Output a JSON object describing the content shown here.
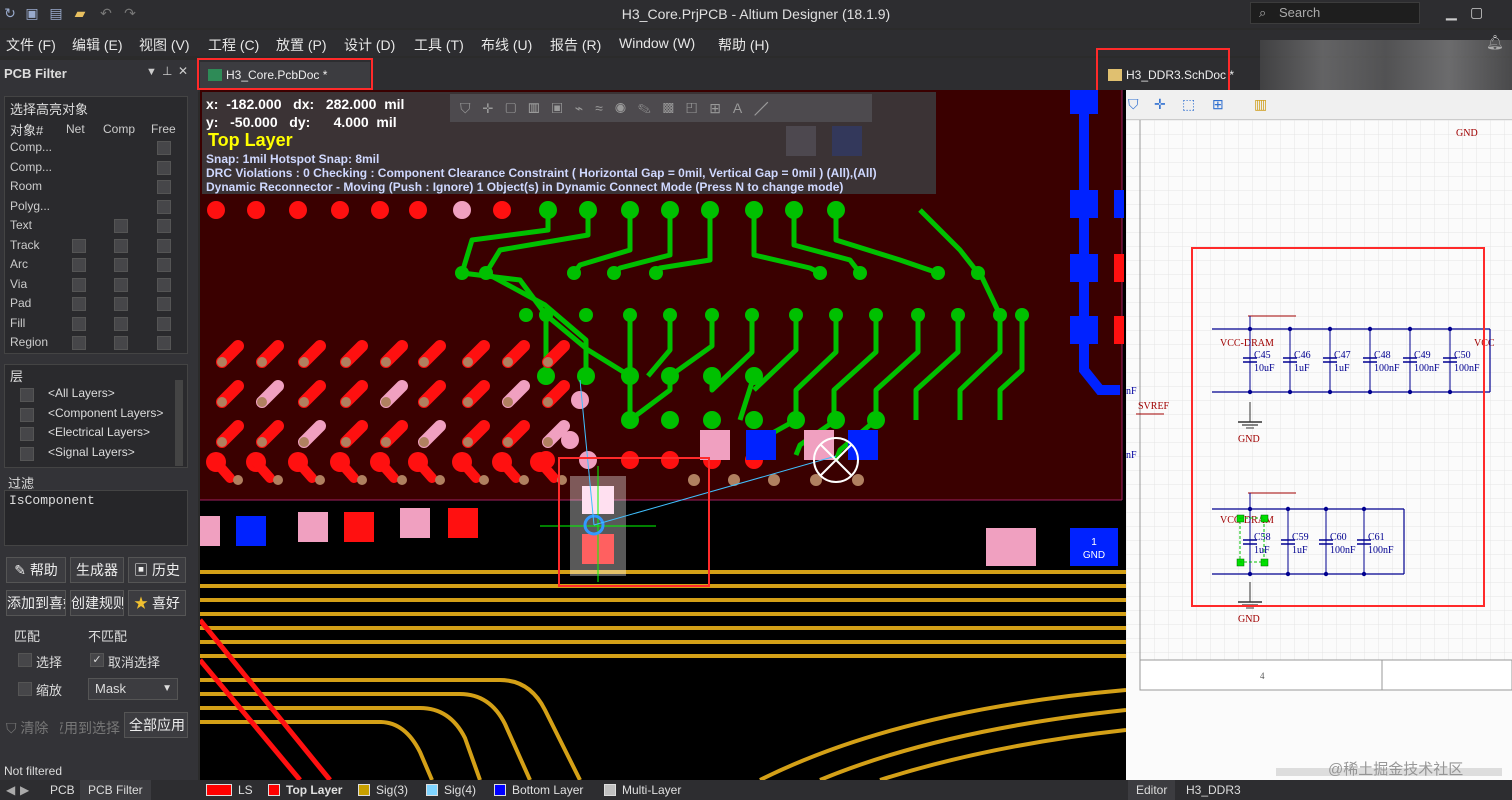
{
  "window": {
    "title": "H3_Core.PrjPCB - Altium Designer (18.1.9)",
    "search_placeholder": "Search"
  },
  "menu": [
    "文件 (F)",
    "编辑 (E)",
    "视图 (V)",
    "工程 (C)",
    "放置 (P)",
    "设计 (D)",
    "工具 (T)",
    "布线 (U)",
    "报告 (R)",
    "Window (W)",
    "帮助 (H)"
  ],
  "panel": {
    "title": "PCB Filter",
    "highlight_title": "选择高亮对象",
    "obj_headers": [
      "对象#",
      "Net",
      "Comp",
      "Free"
    ],
    "objects": [
      "Comp...",
      "Comp...",
      "Room",
      "Polyg...",
      "Text",
      "Track",
      "Arc",
      "Via",
      "Pad",
      "Fill",
      "Region"
    ],
    "layers_title": "层",
    "layers": [
      "<All Layers>",
      "<Component Layers>",
      "<Electrical Layers>",
      "<Signal Layers>"
    ],
    "filter_title": "过滤",
    "filter_text": "IsComponent",
    "buttons": {
      "help": "帮助",
      "builder": "生成器",
      "history": "历史",
      "add_to": "添加到喜好",
      "create_rule": "创建规则",
      "favorite": "喜好"
    },
    "match": "匹配",
    "nomatch": "不匹配",
    "select": "选择",
    "deselect": "取消选择",
    "zoom": "缩放",
    "mask": "Mask",
    "clear": "清除",
    "apply_to": "应用到选择",
    "apply_all": "全部应用"
  },
  "tabs": {
    "pcb": "H3_Core.PcbDoc *",
    "sch": "H3_DDR3.SchDoc *"
  },
  "hud": {
    "x_line": "x:  -182.000   dx:   282.000  mil",
    "y_line": "y:   -50.000   dy:      4.000  mil",
    "layer": "Top Layer",
    "snap": "Snap: 1mil Hotspot Snap: 8mil",
    "drc": "DRC Violations : 0 Checking : Component Clearance Constraint ( Horizontal Gap = 0mil, Vertical Gap = 0mil ) (All),(All)",
    "reconnector": "Dynamic Reconnector - Moving (Push : Ignore) 1 Object(s) in Dynamic Connect Mode (Press N to change mode)"
  },
  "pcb_labels": {
    "gnd_pad": "1",
    "gnd_net": "GND"
  },
  "schematic": {
    "gnd": "GND",
    "vcc1": "VCC-DRAM",
    "vcc2": "VCC-DRAM",
    "vcc_right": "VCC",
    "svref": "SVREF",
    "nf1": "nF",
    "nf2": "nF",
    "row1": [
      {
        "ref": "C45",
        "val": "10uF"
      },
      {
        "ref": "C46",
        "val": "1uF"
      },
      {
        "ref": "C47",
        "val": "1uF"
      },
      {
        "ref": "C48",
        "val": "100nF"
      },
      {
        "ref": "C49",
        "val": "100nF"
      },
      {
        "ref": "C50",
        "val": "100nF"
      }
    ],
    "row2": [
      {
        "ref": "C58",
        "val": "1uF"
      },
      {
        "ref": "C59",
        "val": "1uF"
      },
      {
        "ref": "C60",
        "val": "100nF"
      },
      {
        "ref": "C61",
        "val": "100nF"
      }
    ],
    "frame_num": "4"
  },
  "status": {
    "text": "Not filtered"
  },
  "bottom_tabs": [
    "PCB",
    "PCB Filter"
  ],
  "layer_tabs": [
    {
      "label": "LS",
      "color": "#ff0000"
    },
    {
      "label": "Top Layer",
      "color": "#ff0000"
    },
    {
      "label": "Sig(3)",
      "color": "#c8a000"
    },
    {
      "label": "Sig(4)",
      "color": "#7fd4ff"
    },
    {
      "label": "Bottom Layer",
      "color": "#0000ff"
    },
    {
      "label": "Multi-Layer",
      "color": "#c0c0c0"
    }
  ],
  "sch_tabs": [
    "Editor",
    "H3_DDR3"
  ],
  "watermark": "@稀土掘金技术社区"
}
